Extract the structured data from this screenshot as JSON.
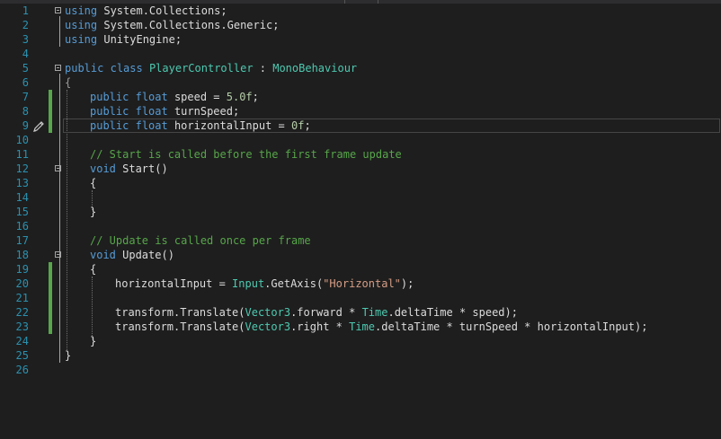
{
  "theme": {
    "background": "#1e1e1e",
    "keyword_color": "#569cd6",
    "type_color": "#4ec9b0",
    "comment_color": "#57a64a",
    "string_color": "#d69d85",
    "line_number_color": "#2b91af",
    "change_marker_color": "#57a64a"
  },
  "editor": {
    "gutter_icon": "pencil-edit-icon",
    "lines": [
      {
        "n": "1",
        "parts": [
          "using",
          " System.Collections;"
        ]
      },
      {
        "n": "2",
        "parts": [
          "using",
          " System.Collections.Generic;"
        ]
      },
      {
        "n": "3",
        "parts": [
          "using",
          " UnityEngine;"
        ]
      },
      {
        "n": "4",
        "parts": []
      },
      {
        "n": "5",
        "parts": [
          "public",
          " ",
          "class",
          " ",
          "PlayerController",
          " : ",
          "MonoBehaviour"
        ]
      },
      {
        "n": "6",
        "parts": [
          "{"
        ]
      },
      {
        "n": "7",
        "parts": [
          "public",
          " ",
          "float",
          " speed = ",
          "5.0f",
          ";"
        ]
      },
      {
        "n": "8",
        "parts": [
          "public",
          " ",
          "float",
          " turnSpeed;"
        ]
      },
      {
        "n": "9",
        "parts": [
          "public",
          " ",
          "float",
          " horizontalInput = ",
          "0f",
          ";"
        ]
      },
      {
        "n": "10",
        "parts": []
      },
      {
        "n": "11",
        "parts": [
          "// Start is called before the first frame update"
        ]
      },
      {
        "n": "12",
        "parts": [
          "void",
          " Start()"
        ]
      },
      {
        "n": "13",
        "parts": [
          "{"
        ]
      },
      {
        "n": "14",
        "parts": []
      },
      {
        "n": "15",
        "parts": [
          "}"
        ]
      },
      {
        "n": "16",
        "parts": []
      },
      {
        "n": "17",
        "parts": [
          "// Update is called once per frame"
        ]
      },
      {
        "n": "18",
        "parts": [
          "void",
          " Update()"
        ]
      },
      {
        "n": "19",
        "parts": [
          "{"
        ]
      },
      {
        "n": "20",
        "parts": [
          "horizontalInput = ",
          "Input",
          ".GetAxis(",
          "\"Horizontal\"",
          ");"
        ]
      },
      {
        "n": "21",
        "parts": []
      },
      {
        "n": "22",
        "parts": [
          "transform.Translate(",
          "Vector3",
          ".forward * ",
          "Time",
          ".deltaTime * speed);"
        ]
      },
      {
        "n": "23",
        "parts": [
          "transform.Translate(",
          "Vector3",
          ".right * ",
          "Time",
          ".deltaTime * turnSpeed * horizontalInput);"
        ]
      },
      {
        "n": "24",
        "parts": [
          "}"
        ]
      },
      {
        "n": "25",
        "parts": [
          "}"
        ]
      },
      {
        "n": "26",
        "parts": []
      }
    ]
  }
}
